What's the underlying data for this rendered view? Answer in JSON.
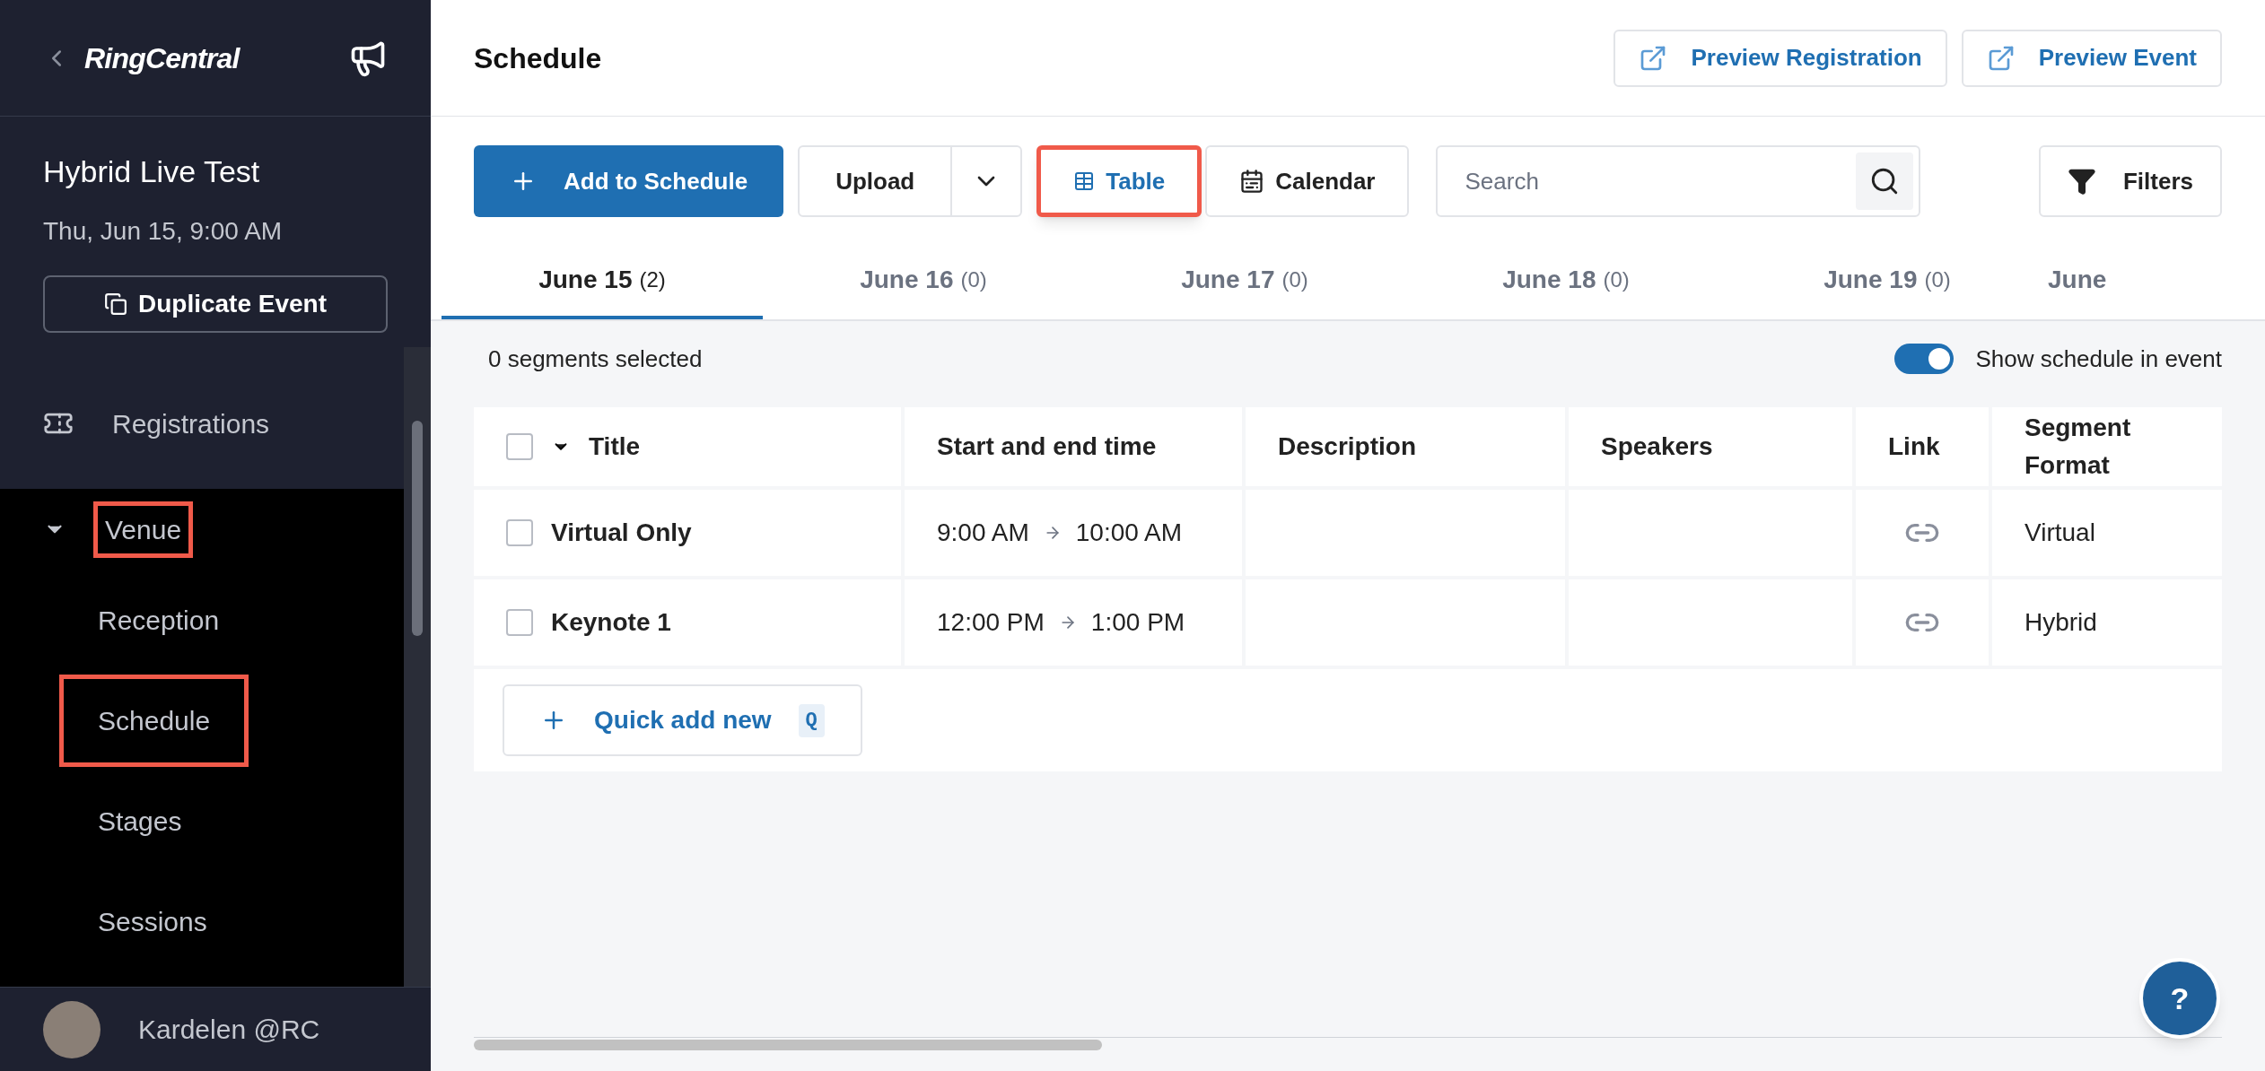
{
  "sidebar": {
    "brand": "RingCentral",
    "event_title": "Hybrid Live Test",
    "event_date": "Thu, Jun 15, 9:00 AM",
    "duplicate_button": "Duplicate Event",
    "nav": [
      {
        "label": "Registrations",
        "kind": "top",
        "highlighted": false
      },
      {
        "label": "Venue",
        "kind": "group",
        "expanded": true,
        "highlighted": true,
        "children": [
          {
            "label": "Reception",
            "highlighted": false
          },
          {
            "label": "Schedule",
            "highlighted": true
          },
          {
            "label": "Stages",
            "highlighted": false
          },
          {
            "label": "Sessions",
            "highlighted": false
          }
        ]
      }
    ],
    "user": "Kardelen @RC"
  },
  "header": {
    "title": "Schedule",
    "buttons": [
      "Preview Registration",
      "Preview Event"
    ]
  },
  "toolbar": {
    "add_button": "Add to Schedule",
    "upload_button": "Upload",
    "views": [
      {
        "label": "Table",
        "kind": "table",
        "selected": true,
        "highlighted": true
      },
      {
        "label": "Calendar",
        "kind": "calendar",
        "selected": false,
        "highlighted": false
      }
    ],
    "search": {
      "placeholder": "Search"
    },
    "filters_button": "Filters"
  },
  "date_tabs": [
    {
      "label": "June 15",
      "count": "(2)",
      "selected": true
    },
    {
      "label": "June 16",
      "count": "(0)",
      "selected": false
    },
    {
      "label": "June 17",
      "count": "(0)",
      "selected": false
    },
    {
      "label": "June 18",
      "count": "(0)",
      "selected": false
    },
    {
      "label": "June 19",
      "count": "(0)",
      "selected": false
    },
    {
      "label": "June",
      "selected": false
    }
  ],
  "selection_text": "0 segments selected",
  "show_schedule": {
    "label": "Show schedule in event",
    "on": true
  },
  "table": {
    "select_all_checked": false,
    "columns": [
      "Title",
      "Start and end time",
      "Description",
      "Speakers",
      "Link",
      "Segment Format"
    ],
    "rows": [
      {
        "title": "Virtual Only",
        "start": "9:00 AM",
        "end": "10:00 AM",
        "checked": false,
        "format": "Virtual"
      },
      {
        "title": "Keynote 1",
        "start": "12:00 PM",
        "end": "1:00 PM",
        "checked": false,
        "format": "Hybrid"
      }
    ],
    "quick_add": {
      "label": "Quick add new",
      "shortcut": "Q"
    }
  },
  "help_button": "?"
}
